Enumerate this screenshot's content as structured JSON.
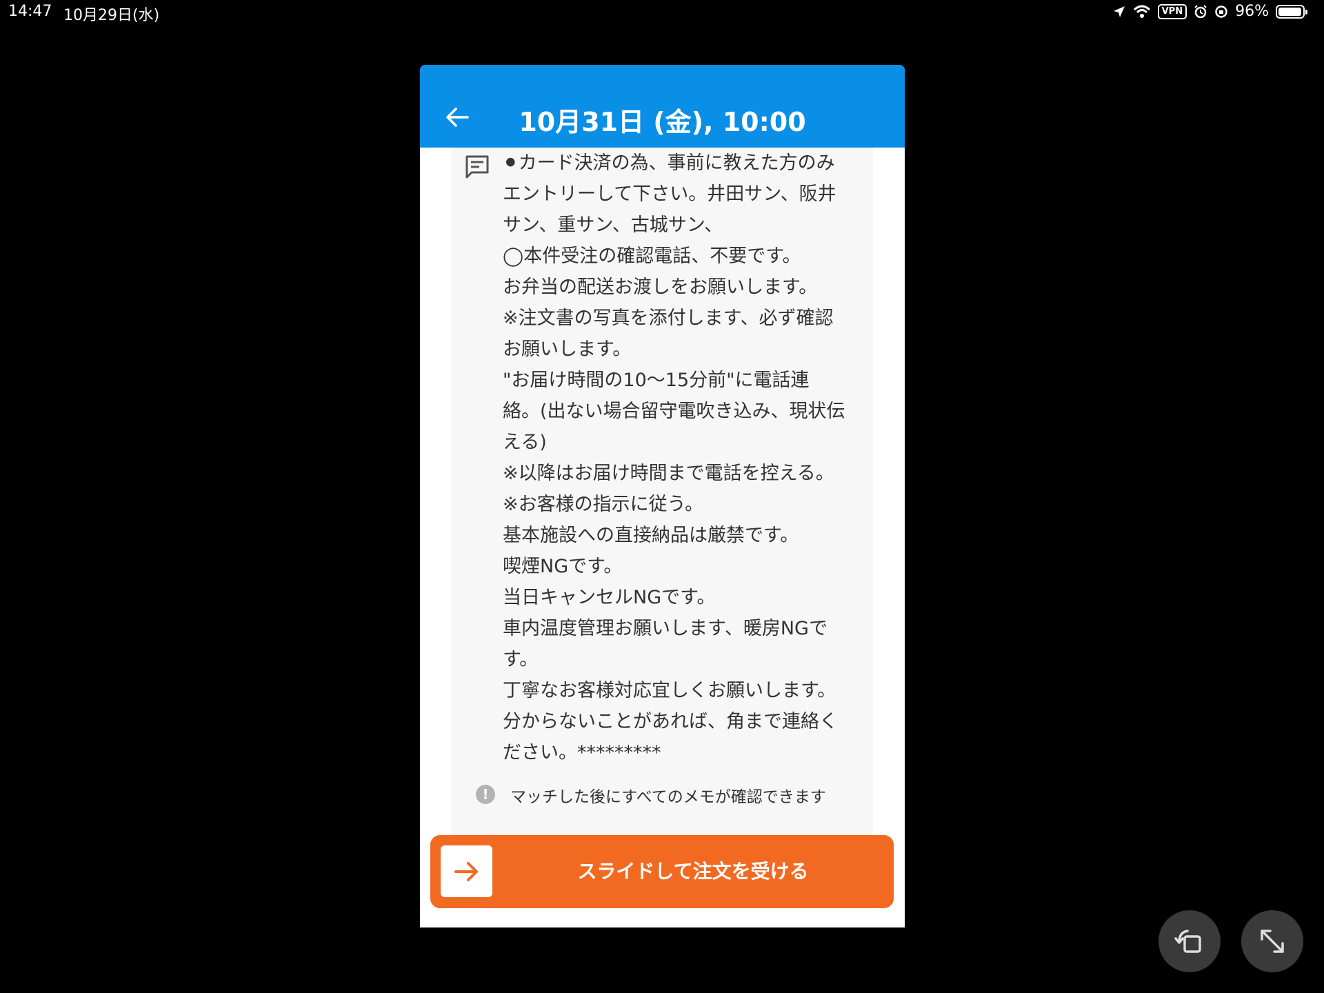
{
  "status_bar": {
    "time": "14:47",
    "date": "10月29日(水)",
    "vpn": "VPN",
    "battery": "96%",
    "battery_level": 0.96
  },
  "header": {
    "title": "10月31日 (金), 10:00",
    "background_color": "#0a8fe6"
  },
  "memo": {
    "lines": [
      "⚫︎カード決済の為、事前に教えた方のみ",
      "エントリーして下さい。井田サン、阪井",
      "サン、重サン、古城サン、",
      "◯本件受注の確認電話、不要です。",
      "お弁当の配送お渡しをお願いします。",
      "※注文書の写真を添付します、必ず確認",
      "お願いします。",
      "\"お届け時間の10～15分前\"に電話連",
      "絡。(出ない場合留守電吹き込み、現状伝",
      "える)",
      "※以降はお届け時間まで電話を控える。",
      "※お客様の指示に従う。",
      "基本施設への直接納品は厳禁です。",
      "喫煙NGです。",
      "当日キャンセルNGです。",
      "車内温度管理お願いします、暖房NGで",
      "す。",
      "丁寧なお客様対応宜しくお願いします。",
      "分からないことがあれば、角まで連絡く",
      "ださい。*********"
    ]
  },
  "notice": {
    "icon": "!",
    "text": "マッチした後にすべてのメモが確認できます"
  },
  "slide_button": {
    "label": "スライドして注文を受ける",
    "color": "#f26a22"
  }
}
